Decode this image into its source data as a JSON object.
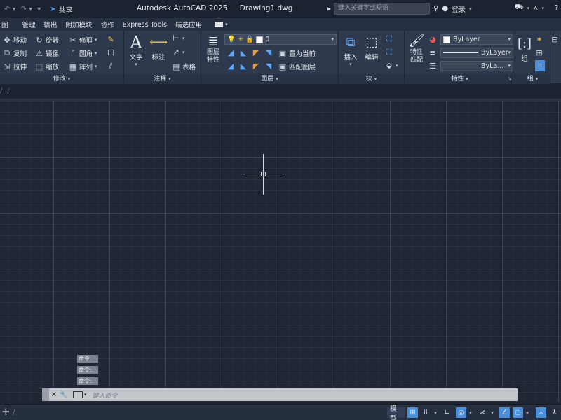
{
  "title_bar": {
    "share_label": "共享",
    "app_title": "Autodesk AutoCAD 2025",
    "document_name": "Drawing1.dwg",
    "search_placeholder": "键入关键字或短语",
    "login_label": "登录"
  },
  "ribbon_tabs": [
    "图",
    "管理",
    "输出",
    "附加模块",
    "协作",
    "Express Tools",
    "精选应用"
  ],
  "panels": {
    "modify": {
      "title": "修改",
      "items": {
        "move": "移动",
        "rotate": "旋转",
        "trim": "修剪",
        "copy": "复制",
        "mirror": "镜像",
        "fillet": "圆角",
        "stretch": "拉伸",
        "scale": "缩放",
        "array": "阵列"
      }
    },
    "annotation": {
      "title": "注释",
      "text": "文字",
      "dimension": "标注",
      "table": "表格"
    },
    "layers": {
      "title": "图层",
      "layer_properties": "图层\n特性",
      "current_layer": "0",
      "set_current": "置为当前",
      "match_layer": "匹配图层"
    },
    "block": {
      "title": "块",
      "insert": "插入",
      "edit": "编辑"
    },
    "properties": {
      "title": "特性",
      "match_properties": "特性\n匹配",
      "color": "ByLayer",
      "lineweight": "ByLayer",
      "linetype": "ByLa..."
    },
    "groups": {
      "title": "组",
      "group": "组"
    }
  },
  "command_history": [
    "命令:",
    "命令:",
    "命令:"
  ],
  "command_line": {
    "placeholder": "键入命令"
  },
  "status_bar": {
    "model_label": "模型"
  },
  "colors": {
    "background": "#1e2431",
    "ribbon": "#2e394d",
    "accent": "#4b8fd8"
  }
}
